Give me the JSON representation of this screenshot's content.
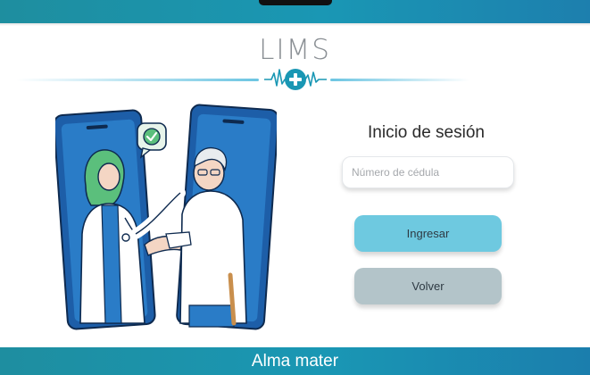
{
  "app": {
    "logo_text": "LIMS"
  },
  "login": {
    "title": "Inicio de sesión",
    "id_placeholder": "Número de cédula",
    "id_value": "",
    "submit_label": "Ingresar",
    "back_label": "Volver"
  },
  "footer": {
    "text": "Alma mater"
  },
  "colors": {
    "brand_teal": "#1a97b4",
    "primary_button": "#6ec9e0",
    "secondary_button": "#b3c4c9",
    "logo_accent": "#6cc5e2"
  },
  "icons": {
    "logo": "medical-cross-heartbeat-icon",
    "illustration": "doctor-patient-telemedicine-illustration",
    "check": "check-bubble-icon"
  }
}
